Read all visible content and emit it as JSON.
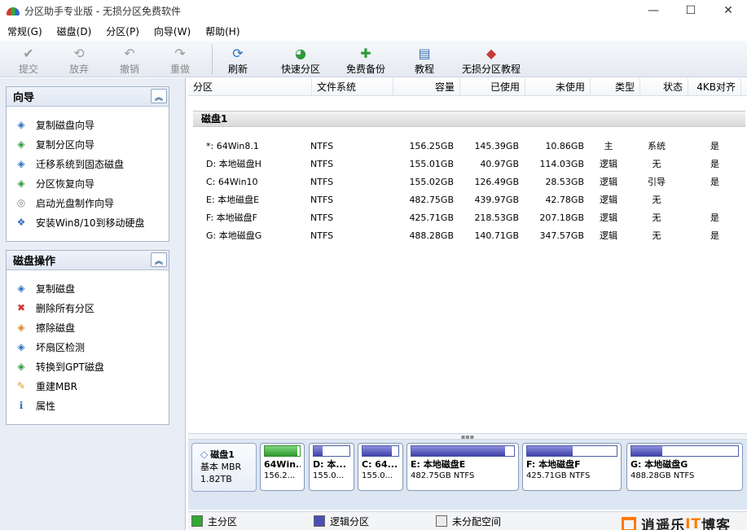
{
  "window": {
    "title": "分区助手专业版 - 无损分区免费软件",
    "minimize": "—",
    "maximize": "☐",
    "close": "✕"
  },
  "menu": [
    "常规(G)",
    "磁盘(D)",
    "分区(P)",
    "向导(W)",
    "帮助(H)"
  ],
  "toolbar": {
    "left": [
      {
        "label": "提交",
        "icon": "check-icon",
        "glyph": "✔"
      },
      {
        "label": "放弃",
        "icon": "discard-icon",
        "glyph": "⟲"
      },
      {
        "label": "撤销",
        "icon": "undo-icon",
        "glyph": "↶"
      },
      {
        "label": "重做",
        "icon": "redo-icon",
        "glyph": "↷"
      }
    ],
    "right": [
      {
        "label": "刷新",
        "icon": "refresh-icon",
        "glyph": "⟳"
      },
      {
        "label": "快速分区",
        "icon": "quick-partition-icon",
        "glyph": "◕"
      },
      {
        "label": "免费备份",
        "icon": "backup-icon",
        "glyph": "✚"
      },
      {
        "label": "教程",
        "icon": "tutorial-icon",
        "glyph": "▤"
      },
      {
        "label": "无损分区教程",
        "icon": "lossless-tutorial-icon",
        "glyph": "◆"
      }
    ]
  },
  "wizard_group": {
    "title": "向导",
    "collapse": "︽",
    "items": [
      {
        "label": "复制磁盘向导",
        "icon": "copy-disk-wizard-icon",
        "glyph": "◈",
        "color": "#2f6fc0"
      },
      {
        "label": "复制分区向导",
        "icon": "copy-partition-wizard-icon",
        "glyph": "◈",
        "color": "#2e9a3a"
      },
      {
        "label": "迁移系统到固态磁盘",
        "icon": "migrate-ssd-icon",
        "glyph": "◈",
        "color": "#2f6fc0"
      },
      {
        "label": "分区恢复向导",
        "icon": "partition-recovery-icon",
        "glyph": "◈",
        "color": "#2e9a3a"
      },
      {
        "label": "启动光盘制作向导",
        "icon": "boot-disc-icon",
        "glyph": "◎",
        "color": "#888888"
      },
      {
        "label": "安装Win8/10到移动硬盘",
        "icon": "windows-to-go-icon",
        "glyph": "❖",
        "color": "#2f6fc0"
      }
    ]
  },
  "disk_ops_group": {
    "title": "磁盘操作",
    "collapse": "︽",
    "items": [
      {
        "label": "复制磁盘",
        "icon": "copy-disk-icon",
        "glyph": "◈",
        "color": "#2f6fc0"
      },
      {
        "label": "删除所有分区",
        "icon": "delete-partitions-icon",
        "glyph": "✖",
        "color": "#d33333"
      },
      {
        "label": "擦除磁盘",
        "icon": "wipe-disk-icon",
        "glyph": "◈",
        "color": "#d9822b"
      },
      {
        "label": "坏扇区检测",
        "icon": "bad-sector-icon",
        "glyph": "◈",
        "color": "#2f6fc0"
      },
      {
        "label": "转换到GPT磁盘",
        "icon": "convert-gpt-icon",
        "glyph": "◈",
        "color": "#2e9a3a"
      },
      {
        "label": "重建MBR",
        "icon": "rebuild-mbr-icon",
        "glyph": "✎",
        "color": "#d9a12b"
      },
      {
        "label": "属性",
        "icon": "properties-icon",
        "glyph": "ℹ",
        "color": "#2f6fc0"
      }
    ]
  },
  "table": {
    "columns": [
      "分区",
      "文件系统",
      "容量",
      "已使用",
      "未使用",
      "类型",
      "状态",
      "4KB对齐"
    ],
    "disk_label": "磁盘1",
    "rows": [
      [
        "*: 64Win8.1",
        "NTFS",
        "156.25GB",
        "145.39GB",
        "10.86GB",
        "主",
        "系统",
        "是"
      ],
      [
        "D: 本地磁盘H",
        "NTFS",
        "155.01GB",
        "40.97GB",
        "114.03GB",
        "逻辑",
        "无",
        "是"
      ],
      [
        "C: 64Win10",
        "NTFS",
        "155.02GB",
        "126.49GB",
        "28.53GB",
        "逻辑",
        "引导",
        "是"
      ],
      [
        "E: 本地磁盘E",
        "NTFS",
        "482.75GB",
        "439.97GB",
        "42.78GB",
        "逻辑",
        "无",
        ""
      ],
      [
        "F: 本地磁盘F",
        "NTFS",
        "425.71GB",
        "218.53GB",
        "207.18GB",
        "逻辑",
        "无",
        "是"
      ],
      [
        "G: 本地磁盘G",
        "NTFS",
        "488.28GB",
        "140.71GB",
        "347.57GB",
        "逻辑",
        "无",
        "是"
      ]
    ]
  },
  "diskmap": {
    "disk": {
      "name": "磁盘1",
      "type": "基本 MBR",
      "size": "1.82TB"
    },
    "partitions": [
      {
        "name": "64Win...",
        "size": "156.2...",
        "kind": "primary",
        "used_fraction": 0.93
      },
      {
        "name": "D: 本...",
        "size": "155.0...",
        "kind": "logical",
        "used_fraction": 0.26
      },
      {
        "name": "C: 64...",
        "size": "155.0...",
        "kind": "logical",
        "used_fraction": 0.82
      },
      {
        "name": "E: 本地磁盘E",
        "size": "482.75GB NTFS",
        "kind": "logical",
        "used_fraction": 0.91
      },
      {
        "name": "F: 本地磁盘F",
        "size": "425.71GB NTFS",
        "kind": "logical",
        "used_fraction": 0.51
      },
      {
        "name": "G: 本地磁盘G",
        "size": "488.28GB NTFS",
        "kind": "logical",
        "used_fraction": 0.29
      }
    ]
  },
  "legend": {
    "primary": "主分区",
    "logical": "逻辑分区",
    "unallocated": "未分配空间",
    "colors": {
      "primary": "#2faa2f",
      "logical": "#4d4fb8",
      "unallocated": "#ececec"
    }
  },
  "watermark": {
    "text_a": "逍遥乐",
    "text_b": "IT",
    "text_c": "博客"
  }
}
